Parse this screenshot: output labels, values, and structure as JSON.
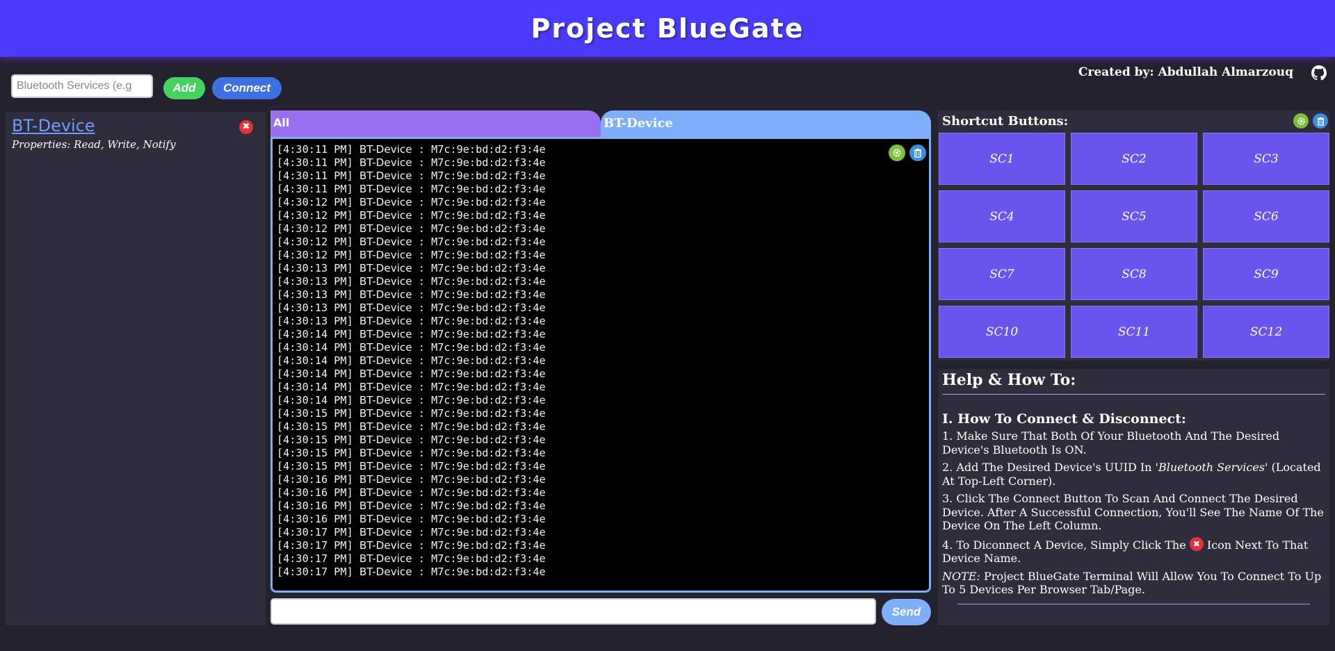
{
  "header": {
    "title": "Project BlueGate"
  },
  "toolbar": {
    "service_placeholder": "Bluetooth Services (e.g",
    "add_label": "Add",
    "connect_label": "Connect",
    "credit": "Created by: Abdullah Almarzouq"
  },
  "device": {
    "name": "BT-Device",
    "close_glyph": "✖",
    "properties": "Properties:  Read,  Write,  Notify"
  },
  "tabs": [
    {
      "label": "All"
    },
    {
      "label": "BT-Device"
    }
  ],
  "terminal": {
    "device": "BT-Device",
    "message": ": M7c:9e:bd:d2:f3:4e",
    "timestamps": [
      "[4:30:11 PM]",
      "[4:30:11 PM]",
      "[4:30:11 PM]",
      "[4:30:11 PM]",
      "[4:30:12 PM]",
      "[4:30:12 PM]",
      "[4:30:12 PM]",
      "[4:30:12 PM]",
      "[4:30:12 PM]",
      "[4:30:13 PM]",
      "[4:30:13 PM]",
      "[4:30:13 PM]",
      "[4:30:13 PM]",
      "[4:30:13 PM]",
      "[4:30:14 PM]",
      "[4:30:14 PM]",
      "[4:30:14 PM]",
      "[4:30:14 PM]",
      "[4:30:14 PM]",
      "[4:30:14 PM]",
      "[4:30:15 PM]",
      "[4:30:15 PM]",
      "[4:30:15 PM]",
      "[4:30:15 PM]",
      "[4:30:15 PM]",
      "[4:30:16 PM]",
      "[4:30:16 PM]",
      "[4:30:16 PM]",
      "[4:30:16 PM]",
      "[4:30:17 PM]",
      "[4:30:17 PM]",
      "[4:30:17 PM]",
      "[4:30:17 PM]"
    ]
  },
  "send": {
    "label": "Send"
  },
  "shortcuts": {
    "title": "Shortcut Buttons:",
    "buttons": [
      "SC1",
      "SC2",
      "SC3",
      "SC4",
      "SC5",
      "SC6",
      "SC7",
      "SC8",
      "SC9",
      "SC10",
      "SC11",
      "SC12"
    ]
  },
  "help": {
    "title": "Help & How To:",
    "section_title": "I. How To Connect & Disconnect:",
    "step1": "1. Make Sure That Both Of Your Bluetooth And The Desired Device's Bluetooth Is ON.",
    "step2_a": "2. Add The Desired Device's UUID In ",
    "step2_em": "'Bluetooth Services'",
    "step2_b": " (Located At Top-Left Corner).",
    "step3": "3. Click The Connect Button To Scan And Connect The Desired Device. After A Successful Connection, You'll See The Name Of The Device On The Left Column.",
    "step4_a": "4. To Diconnect A Device, Simply Click The ",
    "step4_b": " Icon Next To That Device Name.",
    "note_label": "NOTE:",
    "note_text": " Project BlueGate Terminal Will Allow You To Connect To Up To 5 Devices Per Browser Tab/Page."
  },
  "colors": {
    "header": "#4a3bfb",
    "background": "#23222e",
    "panel": "#2f2d3c",
    "add": "#45d262",
    "connect": "#3e6fe3",
    "tab_all": "#9a70f0",
    "tab_device": "#7faefa",
    "shortcut": "#6a55ec",
    "close": "#e8303a"
  },
  "icons": {
    "github": "github-icon",
    "gear": "gear-icon",
    "trash": "trash-icon",
    "close": "close-icon"
  }
}
